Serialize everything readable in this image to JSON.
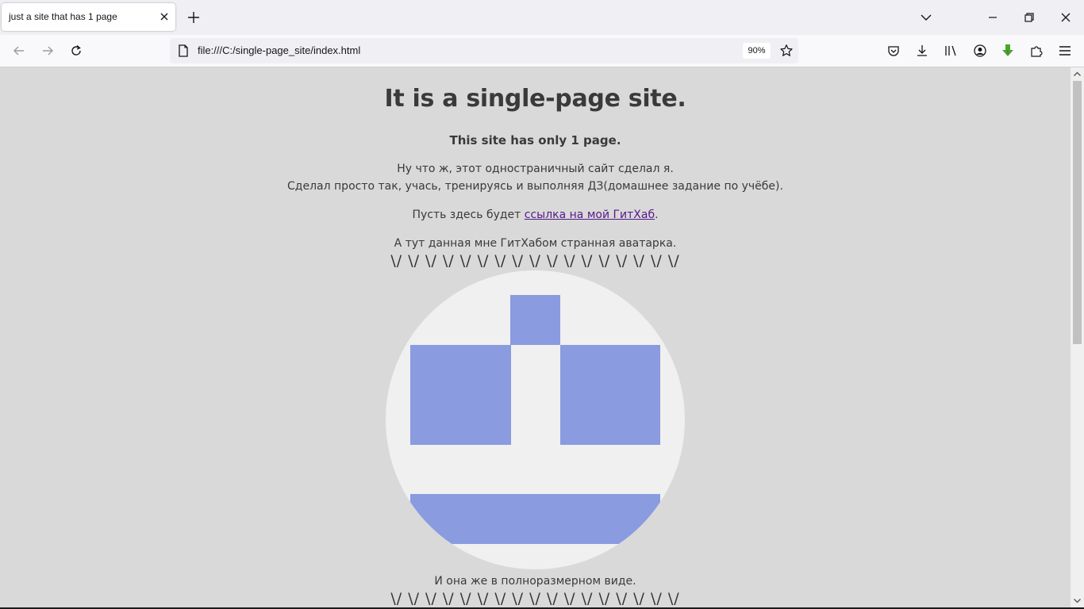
{
  "window": {
    "tab_title": "just a site that has 1 page",
    "url": "file:///C:/single-page_site/index.html",
    "zoom": "90%"
  },
  "icons": {
    "tab_close": "close-icon",
    "new_tab": "plus-icon",
    "list_tabs": "chevron-down-icon",
    "minimize": "minimize-icon",
    "restore": "restore-icon",
    "close_window": "close-icon",
    "back": "back-arrow-icon",
    "forward": "forward-arrow-icon",
    "reload": "reload-icon",
    "page_info": "page-icon",
    "bookmark": "star-icon",
    "pocket": "pocket-icon",
    "downloads": "download-icon",
    "library": "library-icon",
    "account": "account-icon",
    "extension_green": "green-arrow-extension-icon",
    "extensions": "puzzle-icon",
    "menu": "hamburger-menu-icon"
  },
  "page": {
    "title": "It is a single-page site.",
    "subtitle": "This site has only 1 page.",
    "para1_line1": "Ну что ж, этот одностраничный сайт сделал я.",
    "para1_line2": "Сделал просто так, учась, тренируясь и выполняя ДЗ(домашнее задание по учёбе).",
    "link_prefix": "Пусть здесь будет ",
    "link_text": "ссылка на мой ГитХаб",
    "link_suffix": ".",
    "avatar_caption": "А тут данная мне ГитХабом странная аватарка.",
    "zigzag": "\\/ \\/ \\/ \\/ \\/ \\/ \\/ \\/ \\/ \\/ \\/ \\/ \\/ \\/ \\/ \\/ \\/",
    "fullsize_caption": "И она же в полноразмерном виде.",
    "zigzag2": "\\/ \\/ \\/ \\/ \\/ \\/ \\/ \\/ \\/ \\/ \\/ \\/ \\/ \\/ \\/ \\/ \\/"
  },
  "colors": {
    "page_background": "#d9d9d9",
    "avatar_background": "#f0f0f0",
    "avatar_pixels": "#8a9be0",
    "link": "#551a8b",
    "text": "#3a3a3a"
  }
}
